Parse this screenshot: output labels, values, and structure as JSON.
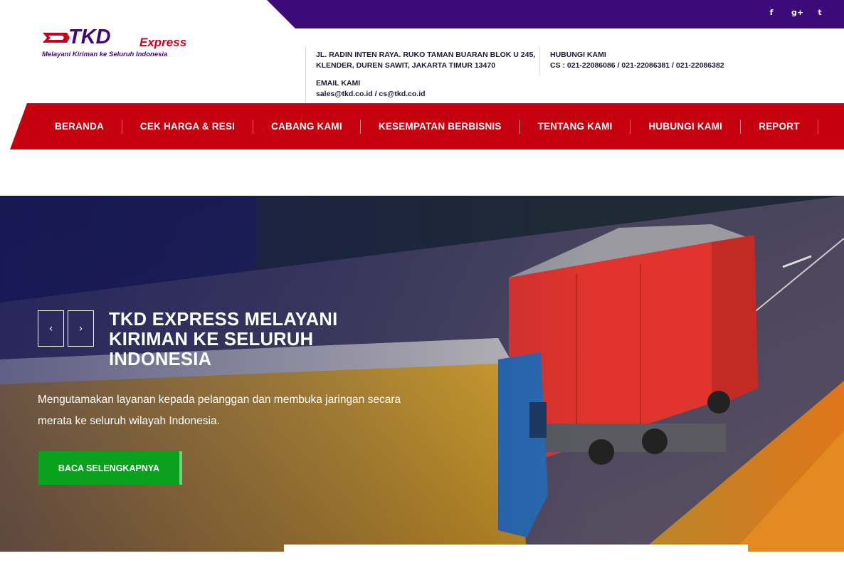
{
  "social": {
    "icons": [
      "facebook-icon",
      "google-plus-icon",
      "twitter-icon"
    ],
    "facebook_glyph": "f",
    "google_glyph": "g+",
    "twitter_glyph": "t"
  },
  "logo": {
    "brand": "TKD",
    "express": "Express",
    "tagline": "Melayani Kiriman ke Seluruh Indonesia"
  },
  "contact": {
    "address_line1": "JL. RADIN INTEN RAYA. RUKO TAMAN BUARAN BLOK U 245,",
    "address_line2": "KLENDER, DUREN SAWIT, JAKARTA TIMUR 13470",
    "phone_label": "HUBUNGI KAMI",
    "phone_value": "CS : 021-22086086 / 021-22086381 / 021-22086382",
    "email_label": "EMAIL KAMI",
    "email_value": "sales@tkd.co.id / cs@tkd.co.id"
  },
  "nav": {
    "items": [
      {
        "label": "BERANDA"
      },
      {
        "label": "CEK HARGA & RESI"
      },
      {
        "label": "CABANG KAMI"
      },
      {
        "label": "KESEMPATAN BERBISNIS"
      },
      {
        "label": "TENTANG KAMI"
      },
      {
        "label": "HUBUNGI KAMI"
      },
      {
        "label": "REPORT"
      }
    ]
  },
  "hero": {
    "prev_glyph": "‹",
    "next_glyph": "›",
    "title": "TKD EXPRESS MELAYANI KIRIMAN KE SELURUH INDONESIA",
    "description": "Mengutamakan layanan kepada pelanggan dan membuka jaringan secara merata ke seluruh wilayah Indonesia.",
    "cta_label": "BACA SELENGKAPNYA"
  },
  "colors": {
    "purple": "#3d0a7a",
    "red": "#c5000f",
    "green": "#0aa11e"
  }
}
